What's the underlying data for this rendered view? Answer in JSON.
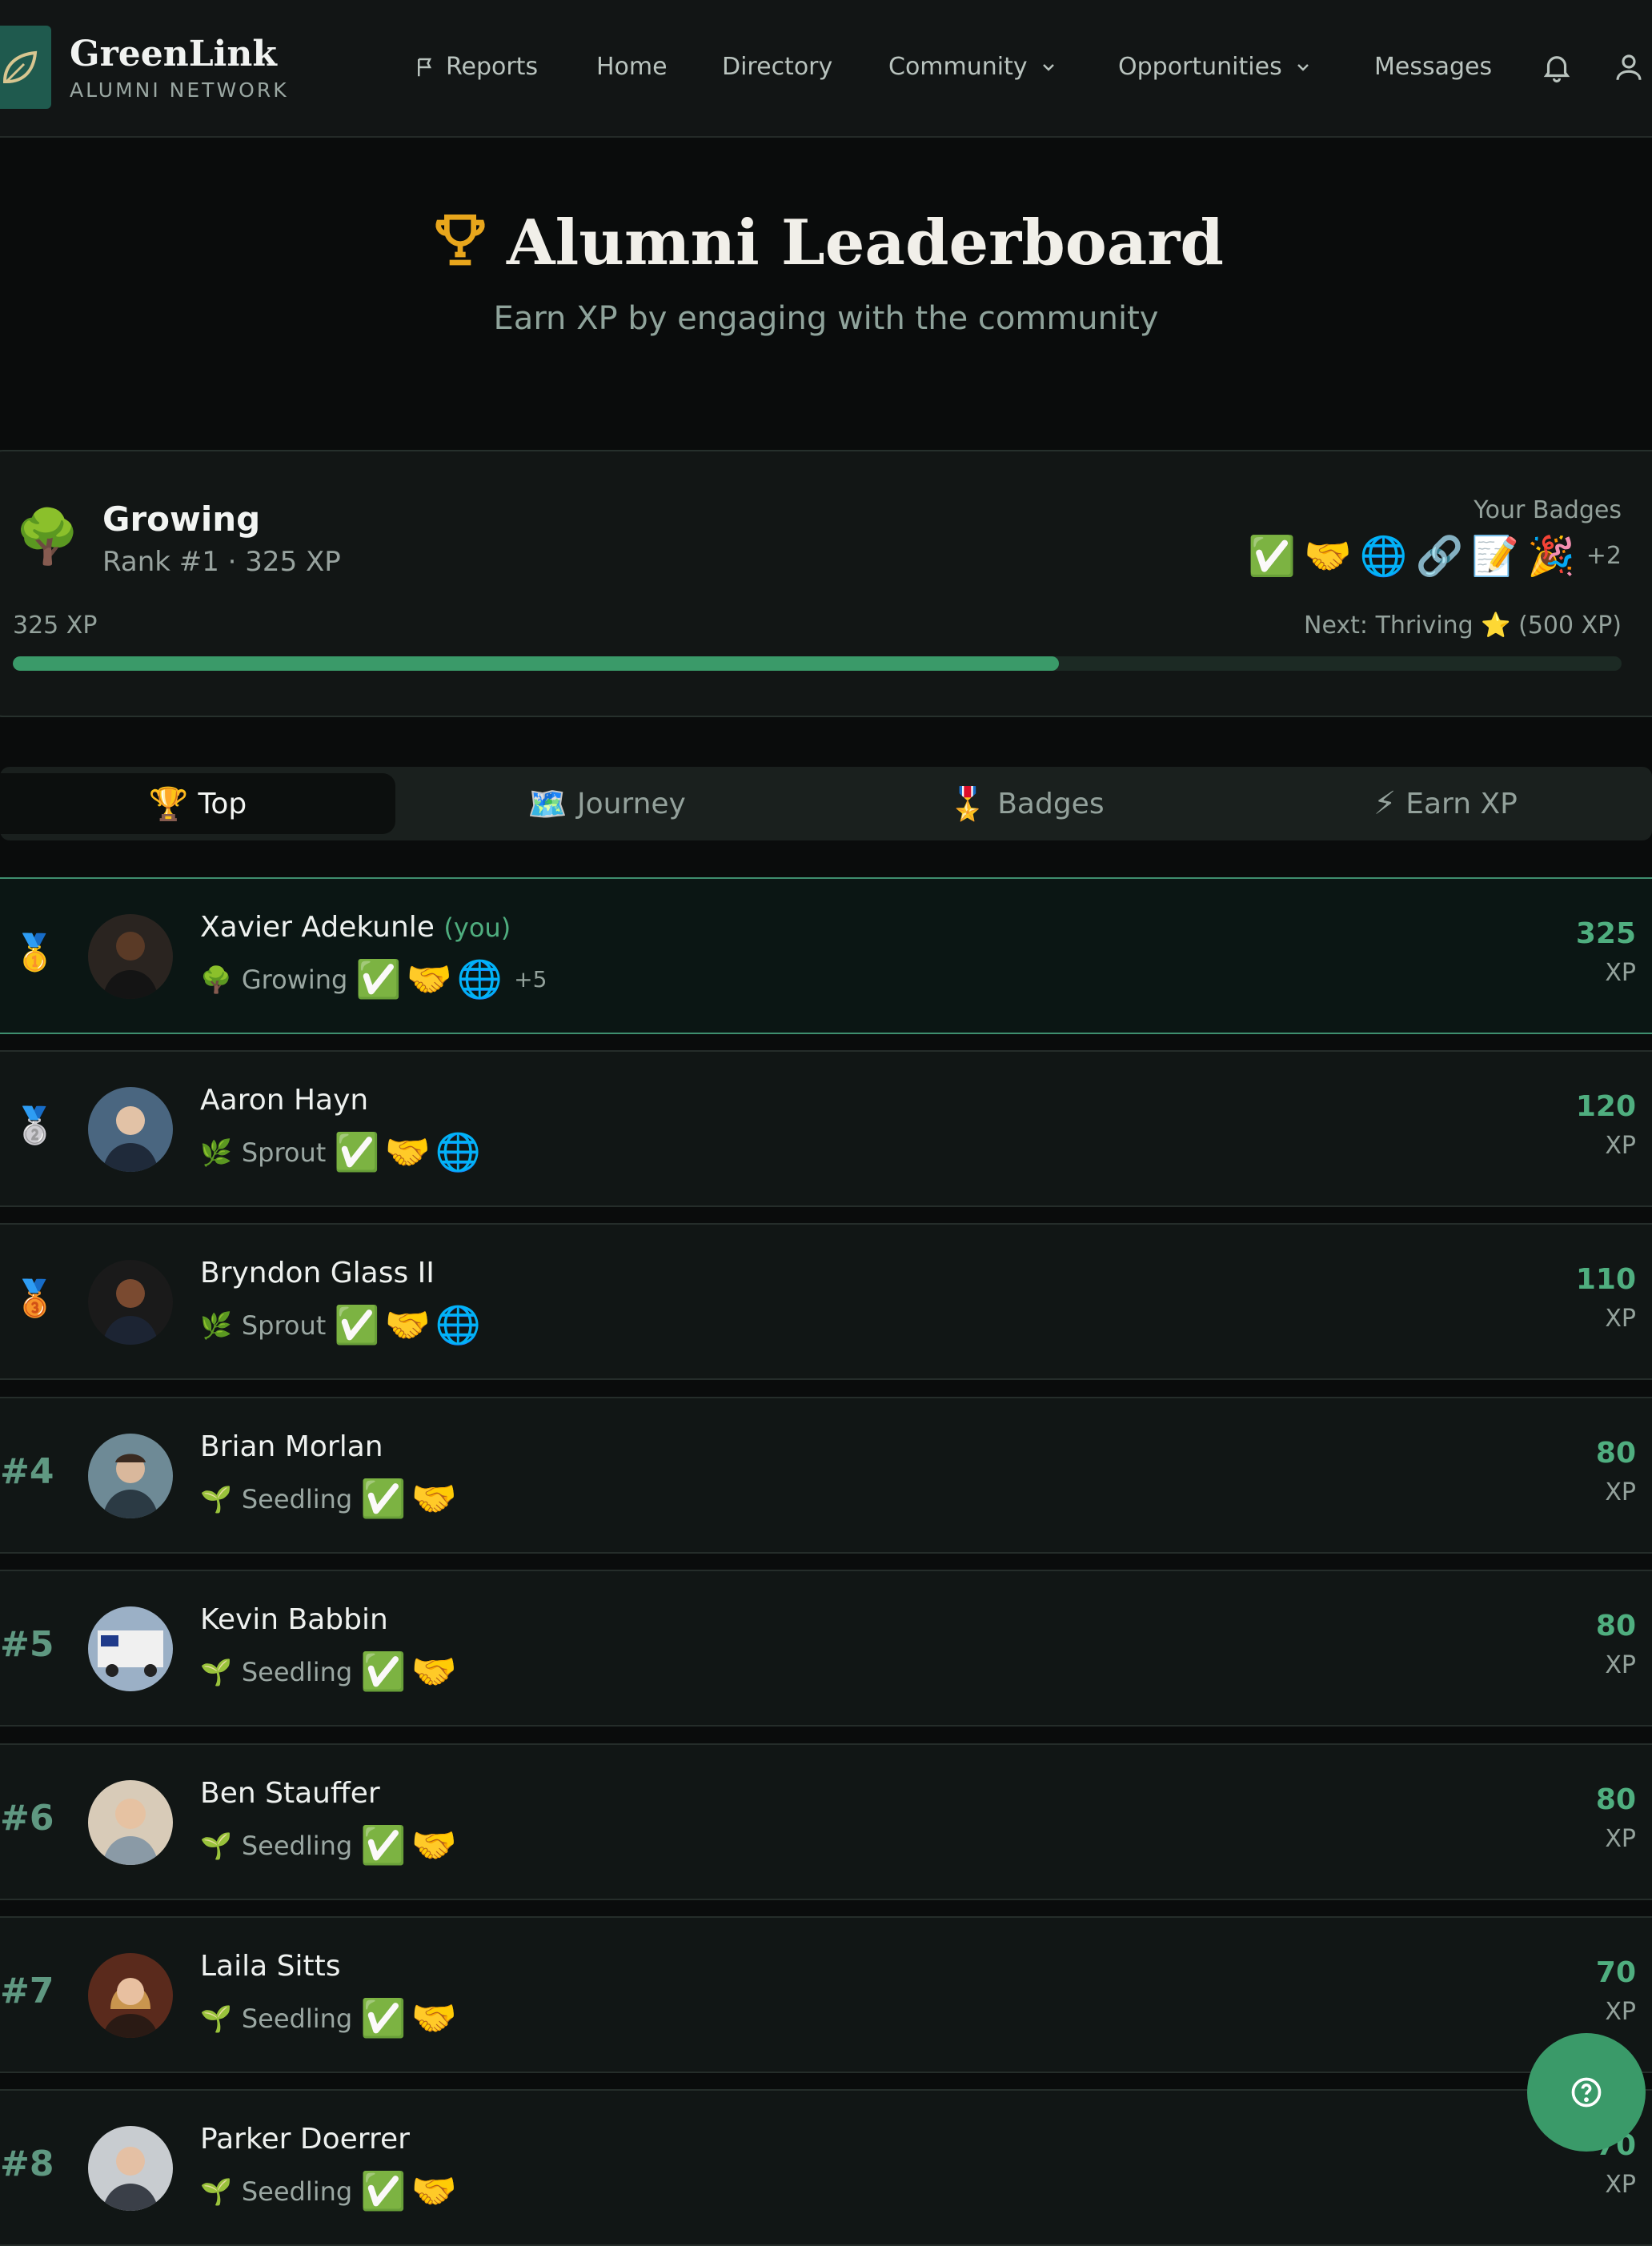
{
  "brand": {
    "name": "GreenLink",
    "sub": "ALUMNI NETWORK"
  },
  "nav": {
    "reports": "Reports",
    "home": "Home",
    "directory": "Directory",
    "community": "Community",
    "opportunities": "Opportunities",
    "messages": "Messages"
  },
  "hero": {
    "title": "Alumni Leaderboard",
    "subtitle": "Earn XP by engaging with the community"
  },
  "level": {
    "emoji": "🌳",
    "name": "Growing",
    "rank_line": "Rank #1 · 325 XP",
    "badges_label": "Your Badges",
    "badges": [
      "✅",
      "🤝",
      "🌐",
      "🔗",
      "📝",
      "🎉"
    ],
    "badges_more": "+2",
    "xp_current": "325 XP",
    "next_label": "Next: Thriving ⭐ (500 XP)",
    "progress_fraction": 0.65
  },
  "tabs": [
    {
      "icon": "🏆",
      "label": "Top"
    },
    {
      "icon": "🗺️",
      "label": "Journey"
    },
    {
      "icon": "🎖️",
      "label": "Badges"
    },
    {
      "icon": "⚡",
      "label": "Earn XP"
    }
  ],
  "leaderboard": [
    {
      "rank": "🥇",
      "name": "Xavier Adekunle",
      "you": "(you)",
      "level_icon": "🌳",
      "level": "Growing",
      "badges": [
        "✅",
        "🤝",
        "🌐"
      ],
      "more": "+5",
      "xp": "325",
      "unit": "XP"
    },
    {
      "rank": "🥈",
      "name": "Aaron Hayn",
      "level_icon": "🌿",
      "level": "Sprout",
      "badges": [
        "✅",
        "🤝",
        "🌐"
      ],
      "xp": "120",
      "unit": "XP"
    },
    {
      "rank": "🥉",
      "name": "Bryndon Glass II",
      "level_icon": "🌿",
      "level": "Sprout",
      "badges": [
        "✅",
        "🤝",
        "🌐"
      ],
      "xp": "110",
      "unit": "XP"
    },
    {
      "rank": "#4",
      "name": "Brian Morlan",
      "level_icon": "🌱",
      "level": "Seedling",
      "badges": [
        "✅",
        "🤝"
      ],
      "xp": "80",
      "unit": "XP"
    },
    {
      "rank": "#5",
      "name": "Kevin Babbin",
      "level_icon": "🌱",
      "level": "Seedling",
      "badges": [
        "✅",
        "🤝"
      ],
      "xp": "80",
      "unit": "XP"
    },
    {
      "rank": "#6",
      "name": "Ben Stauffer",
      "level_icon": "🌱",
      "level": "Seedling",
      "badges": [
        "✅",
        "🤝"
      ],
      "xp": "80",
      "unit": "XP"
    },
    {
      "rank": "#7",
      "name": "Laila Sitts",
      "level_icon": "🌱",
      "level": "Seedling",
      "badges": [
        "✅",
        "🤝"
      ],
      "xp": "70",
      "unit": "XP"
    },
    {
      "rank": "#8",
      "name": "Parker Doerrer",
      "level_icon": "🌱",
      "level": "Seedling",
      "badges": [
        "✅",
        "🤝"
      ],
      "xp": "70",
      "unit": "XP"
    }
  ],
  "colors": {
    "accent": "#3a9a69",
    "background": "#0a0c0c",
    "card": "#111615"
  }
}
